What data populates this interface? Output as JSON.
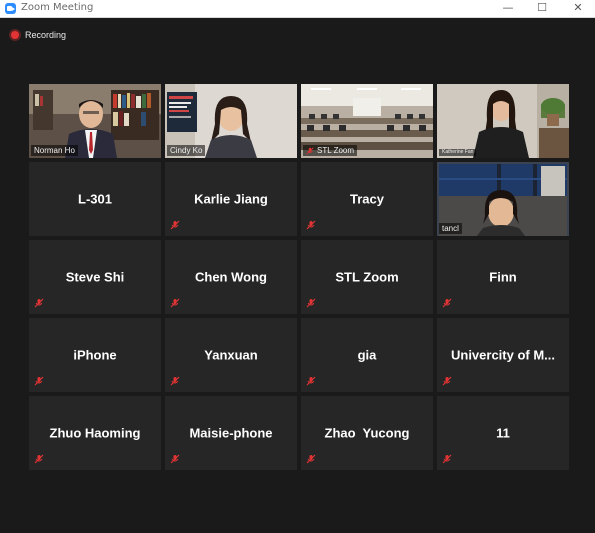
{
  "window": {
    "title": "Zoom Meeting",
    "minimize_glyph": "—",
    "maximize_glyph": "☐",
    "close_glyph": "✕"
  },
  "recording": {
    "label": "Recording",
    "icon": "recording-dot-icon"
  },
  "participants": [
    {
      "name": "Norman Ho",
      "type": "video",
      "muted": false
    },
    {
      "name": "Cindy Ko",
      "type": "video",
      "muted": false
    },
    {
      "name": "STL Zoom",
      "type": "video",
      "muted": true
    },
    {
      "name": "Katherine Fan",
      "type": "video",
      "muted": false
    },
    {
      "name": "L-301",
      "type": "name",
      "muted": false
    },
    {
      "name": "Karlie Jiang",
      "type": "name",
      "muted": true
    },
    {
      "name": "Tracy",
      "type": "name",
      "muted": true
    },
    {
      "name": "tancl",
      "type": "video",
      "muted": false,
      "active_speaker": true
    },
    {
      "name": "Steve Shi",
      "type": "name",
      "muted": true
    },
    {
      "name": "Chen Wong",
      "type": "name",
      "muted": true
    },
    {
      "name": "STL Zoom",
      "type": "name",
      "muted": true
    },
    {
      "name": "Finn",
      "type": "name",
      "muted": true
    },
    {
      "name": "iPhone",
      "type": "name",
      "muted": true
    },
    {
      "name": "Yanxuan",
      "type": "name",
      "muted": true
    },
    {
      "name": "gia",
      "type": "name",
      "muted": true
    },
    {
      "name": "Univercity of M...",
      "type": "name",
      "muted": true
    },
    {
      "name": "Zhuo Haoming",
      "type": "name",
      "muted": true
    },
    {
      "name": "Maisie-phone",
      "type": "name",
      "muted": true
    },
    {
      "name": "Zhao  Yucong",
      "type": "name",
      "muted": true
    },
    {
      "name": "11",
      "type": "name",
      "muted": true
    }
  ],
  "colors": {
    "background": "#1a1a1a",
    "tile": "#262626",
    "active_speaker_border": "#c9d542",
    "muted_icon": "#e23434"
  }
}
